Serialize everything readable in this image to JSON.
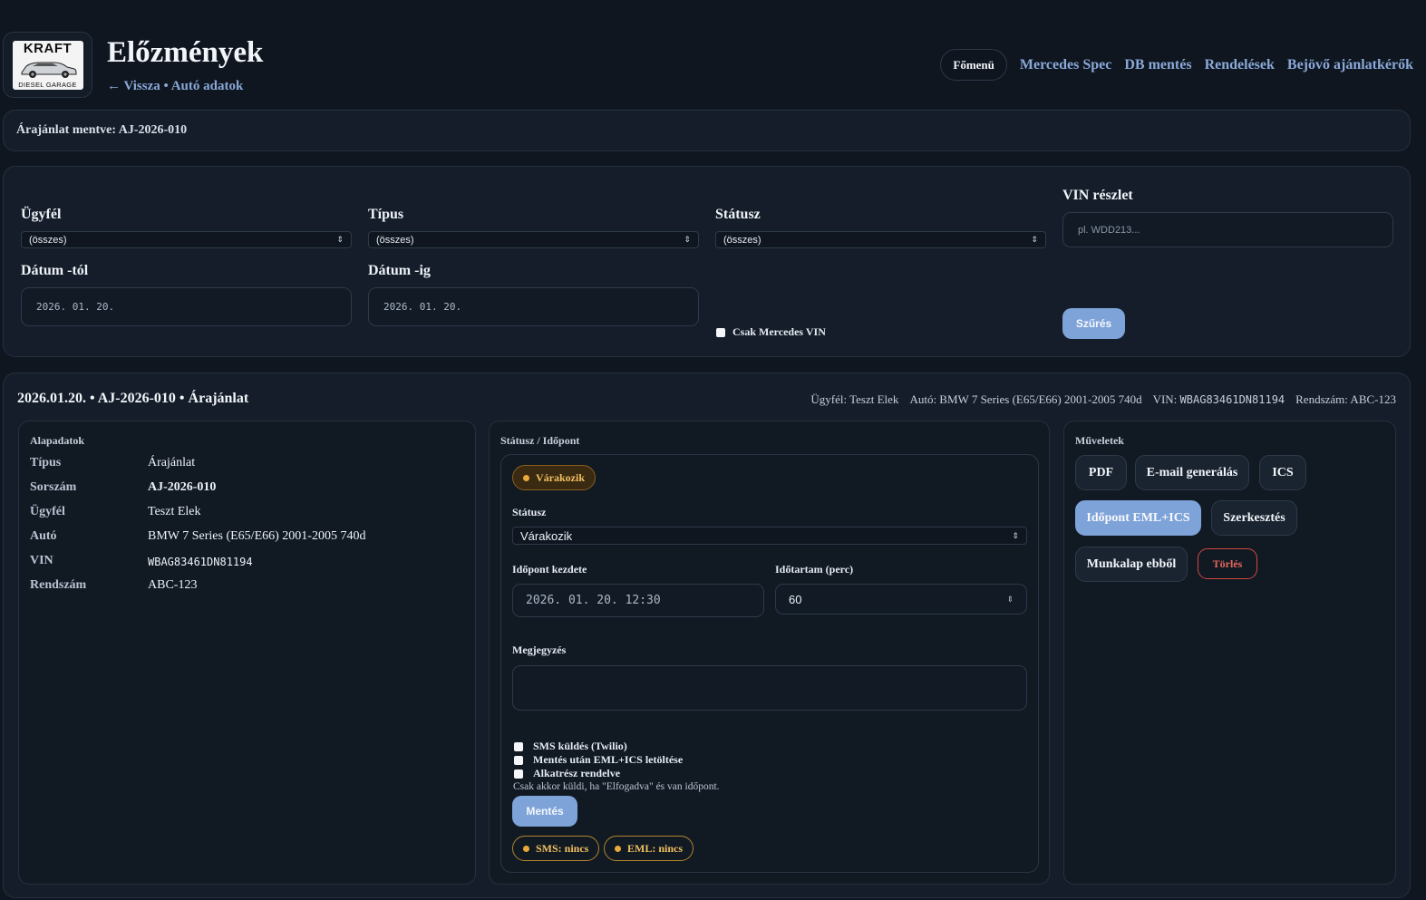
{
  "header": {
    "logo": {
      "top_text": "KRAFT",
      "bottom_text": "DIESEL GARAGE"
    },
    "title": "Előzmények",
    "back_link": "← Vissza",
    "separator": "•",
    "car_data_link": "Autó adatok",
    "nav": {
      "main_menu": "Főmenü",
      "mercedes_spec": "Mercedes Spec",
      "db_save": "DB mentés",
      "orders": "Rendelések",
      "incoming_requests": "Bejövő ajánlatkérők"
    }
  },
  "notice": {
    "text": "Árajánlat mentve: AJ-2026-010"
  },
  "filters": {
    "customer": {
      "label": "Ügyfél",
      "value": "(összes)"
    },
    "type": {
      "label": "Típus",
      "value": "(összes)"
    },
    "status": {
      "label": "Státusz",
      "value": "(összes)"
    },
    "vin": {
      "label": "VIN részlet",
      "placeholder": "pl. WDD213..."
    },
    "date_from": {
      "label": "Dátum -tól",
      "value": "2026. 01. 20."
    },
    "date_to": {
      "label": "Dátum -ig",
      "value": "2026. 01. 20."
    },
    "mercedes_only": {
      "label": "Csak Mercedes VIN",
      "checked": false
    },
    "filter_button": "Szűrés"
  },
  "record": {
    "title": "2026.01.20. • AJ-2026-010 • Árajánlat",
    "meta": {
      "customer": "Ügyfél: Teszt Elek",
      "car": "Autó: BMW 7 Series (E65/E66) 2001-2005 740d",
      "vin_label": "VIN:",
      "vin_value": "WBAG83461DN81194",
      "plate": "Rendszám: ABC-123"
    },
    "basics": {
      "title": "Alapadatok",
      "rows": [
        {
          "key": "Típus",
          "value": "Árajánlat"
        },
        {
          "key": "Sorszám",
          "value": "AJ-2026-010"
        },
        {
          "key": "Ügyfél",
          "value": "Teszt Elek"
        },
        {
          "key": "Autó",
          "value": "BMW 7 Series (E65/E66) 2001-2005 740d"
        },
        {
          "key": "VIN",
          "value": "WBAG83461DN81194"
        },
        {
          "key": "Rendszám",
          "value": "ABC-123"
        }
      ]
    },
    "status_panel": {
      "title": "Státusz / Időpont",
      "badge": "Várakozik",
      "status_label": "Státusz",
      "status_value": "Várakozik",
      "start_label": "Időpont kezdete",
      "start_value": "2026. 01. 20. 12:30",
      "duration_label": "Időtartam (perc)",
      "duration_value": "60",
      "note_label": "Megjegyzés",
      "note_value": "",
      "checkboxes": [
        {
          "label": "SMS küldés (Twilio)",
          "checked": false
        },
        {
          "label": "Mentés után EML+ICS letöltése",
          "checked": false
        },
        {
          "label": "Alkatrész rendelve",
          "checked": false
        }
      ],
      "hint": "Csak akkor küldi, ha \"Elfogadva\" és van időpont.",
      "save_button": "Mentés",
      "sms_status": "SMS: nincs",
      "eml_status": "EML: nincs"
    },
    "actions": {
      "title": "Műveletek",
      "pdf": "PDF",
      "email": "E-mail generálás",
      "ics": "ICS",
      "appointment": "Időpont EML+ICS",
      "edit": "Szerkesztés",
      "worksheet": "Munkalap ebből",
      "delete": "Törlés"
    }
  },
  "colors": {
    "background": "#0f1620",
    "panel": "#141d29",
    "accent": "#7ea3d9",
    "link": "#8aa8d8",
    "warning": "#f0c060",
    "danger": "#e8685c"
  }
}
